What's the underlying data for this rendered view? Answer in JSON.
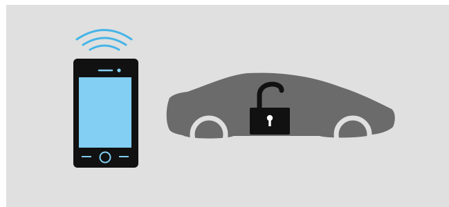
{
  "scene": {
    "background_color": "#dfe0df",
    "phone": {
      "body_color": "#111111",
      "screen_color": "#82cff3",
      "signal_color": "#45b4e8",
      "icons": [
        "wifi-signal-icon",
        "speaker-slot-icon",
        "camera-dot-icon",
        "home-button-icon"
      ]
    },
    "car": {
      "body_color": "#6b6b6b",
      "wheel_color": "#dfe0df",
      "icons": [
        "car-silhouette-icon",
        "unlocked-padlock-icon"
      ]
    },
    "padlock": {
      "state": "unlocked",
      "color": "#111111",
      "keyhole_color": "#ffffff"
    }
  }
}
